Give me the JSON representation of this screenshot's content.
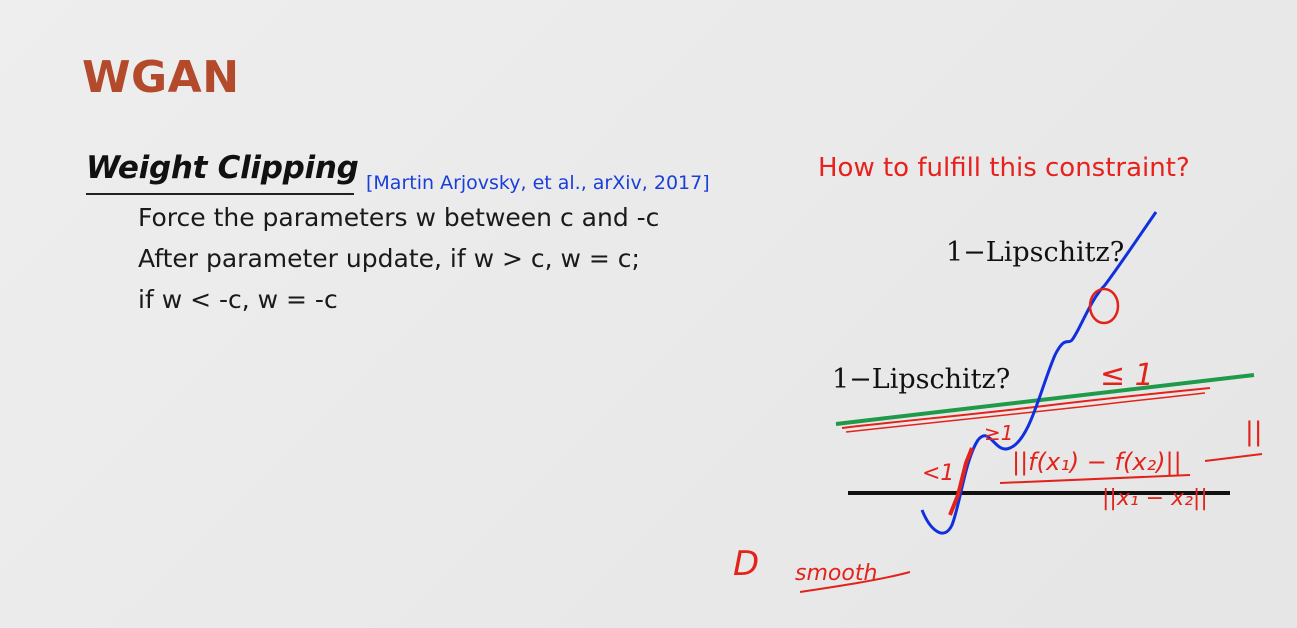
{
  "slide": {
    "title": "WGAN",
    "subheading": "Weight Clipping",
    "citation": "[Martin Arjovsky, et al., arXiv, 2017]",
    "lines": [
      "Force the parameters w between c and -c",
      "After parameter update, if w > c, w = c;",
      "if w < -c, w = -c"
    ]
  },
  "figure": {
    "question": "How to fulfill this constraint?",
    "label_top": "1−Lipschitz?",
    "label_mid": "1−Lipschitz?"
  },
  "annotations": {
    "le_one": "≤ 1",
    "ratio_numerator": "||f(x₁) − f(x₂)||",
    "ratio_denominator": "||x₁ − x₂||",
    "lt_one": "<1",
    "ge_one": "≥1",
    "d_label": "D",
    "smooth": "smooth"
  },
  "colors": {
    "title": "#b34a2c",
    "citation": "#1a3fd9",
    "question": "#e8211c",
    "curve": "#1030e0",
    "green_line": "#1f9a4a",
    "red_ink": "#e3231b",
    "axis": "#111111"
  }
}
